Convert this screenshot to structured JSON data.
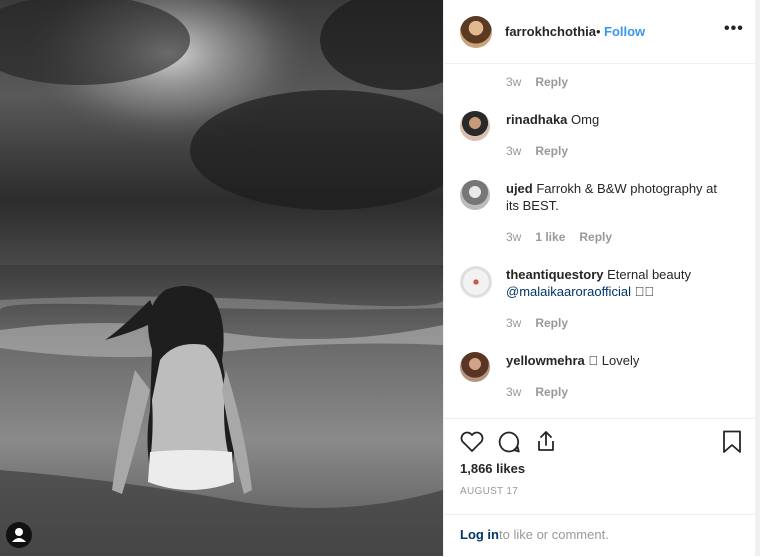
{
  "post": {
    "username": "farrokhchothia",
    "separator": "•",
    "follow_label": "Follow",
    "more_label": "•••"
  },
  "comments": [
    {
      "username": "",
      "text": "",
      "age": "3w",
      "reply_label": "Reply"
    },
    {
      "username": "rinadhaka",
      "text": "Omg",
      "age": "3w",
      "reply_label": "Reply"
    },
    {
      "username": "ujed",
      "text": "Farrokh & B&W photography at its BEST.",
      "age": "3w",
      "likes": "1 like",
      "reply_label": "Reply"
    },
    {
      "username": "theantiquestory",
      "text": "Eternal beauty",
      "mention": "@malaikaaroraofficial",
      "emoji": "󾓥󾓥",
      "age": "3w",
      "reply_label": "Reply"
    },
    {
      "username": "yellowmehra",
      "emoji": "󾓥",
      "text": "Lovely",
      "age": "3w",
      "reply_label": "Reply"
    }
  ],
  "actions": {
    "likes_count": "1,866 likes",
    "date": "AUGUST 17",
    "icons": [
      "heart-icon",
      "comment-icon",
      "share-icon",
      "bookmark-icon"
    ]
  },
  "login": {
    "link_label": "Log in",
    "rest_text": "to like or comment."
  },
  "colors": {
    "link_blue": "#3897f0",
    "mention_blue": "#003569",
    "muted_gray": "#999999",
    "text_dark": "#262626"
  }
}
